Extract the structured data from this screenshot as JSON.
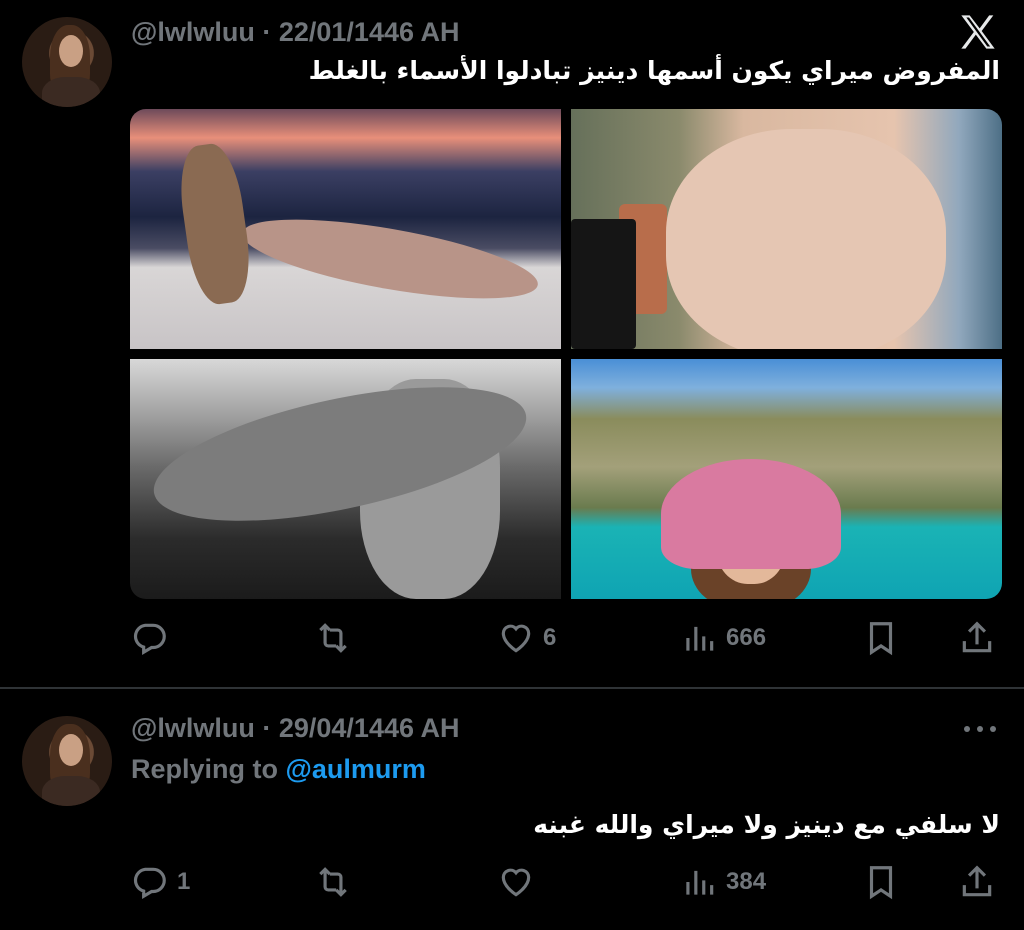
{
  "tweets": [
    {
      "handle": "@lwlwluu",
      "separator": "·",
      "date": "22/01/1446 AH",
      "text": "المفروض ميراي يكون أسمها دينيز تبادلوا الأسماء بالغلط",
      "logo_icon": "x-logo-icon",
      "media": [
        "photo-1",
        "photo-2",
        "photo-3",
        "photo-4"
      ],
      "actions": {
        "reply": {
          "icon": "reply-icon",
          "count": ""
        },
        "retweet": {
          "icon": "retweet-icon",
          "count": ""
        },
        "like": {
          "icon": "heart-icon",
          "count": "6"
        },
        "views": {
          "icon": "views-icon",
          "count": "666"
        },
        "bookmark": {
          "icon": "bookmark-icon"
        },
        "share": {
          "icon": "share-icon"
        }
      }
    },
    {
      "handle": "@lwlwluu",
      "separator": "·",
      "date": "29/04/1446 AH",
      "replying_prefix": "Replying to",
      "replying_to": "@aulmurm",
      "text": "لا سلفي مع دينيز ولا ميراي والله غبنه",
      "more_icon": "more-icon",
      "actions": {
        "reply": {
          "icon": "reply-icon",
          "count": "1"
        },
        "retweet": {
          "icon": "retweet-icon",
          "count": ""
        },
        "like": {
          "icon": "heart-icon",
          "count": ""
        },
        "views": {
          "icon": "views-icon",
          "count": "384"
        },
        "bookmark": {
          "icon": "bookmark-icon"
        },
        "share": {
          "icon": "share-icon"
        }
      }
    }
  ],
  "colors": {
    "background": "#000000",
    "text": "#ffffff",
    "muted": "#71767b",
    "link": "#1d9bf0",
    "divider": "#2f3336"
  }
}
